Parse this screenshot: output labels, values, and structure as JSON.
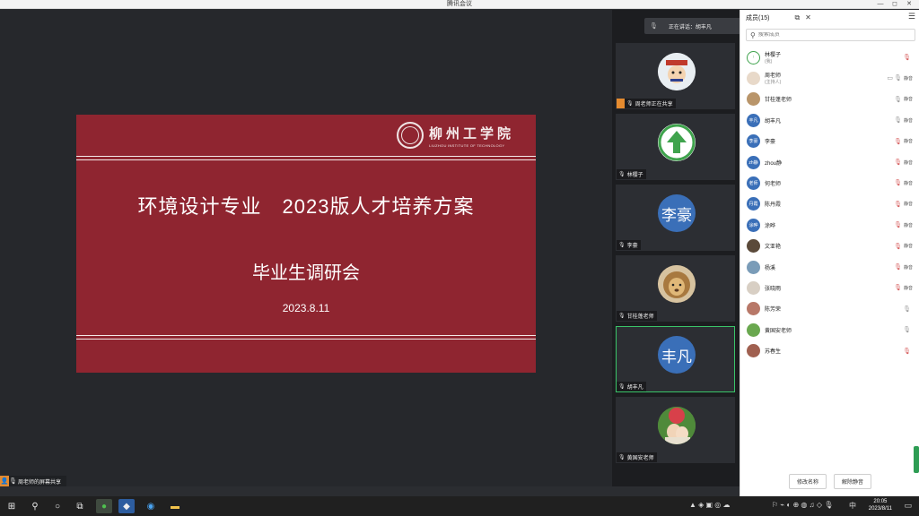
{
  "window": {
    "title": "腾讯会议",
    "controls": [
      "—",
      "◻",
      "✕"
    ]
  },
  "slide": {
    "logo_cn": "柳州工学院",
    "logo_en": "LIUZHOU INSTITUTE OF TECHNOLOGY",
    "title": "环境设计专业　2023版人才培养方案",
    "subtitle": "毕业生调研会",
    "date": "2023.8.11"
  },
  "share_badge": "周老师的屏幕共享",
  "speaking": {
    "label": "正在讲话：胡丰凡"
  },
  "video_tiles": [
    {
      "name": "周老师正在共享",
      "avatar_text": "",
      "color": "#f0f0f0",
      "sharing": true
    },
    {
      "name": "林樱子",
      "avatar_text": "",
      "color": "#ffffff"
    },
    {
      "name": "李豪",
      "avatar_text": "李豪",
      "color": "#3a6fb8"
    },
    {
      "name": "甘桂蓬老师",
      "avatar_text": "",
      "color": "#c9b08a"
    },
    {
      "name": "胡丰凡",
      "avatar_text": "丰凡",
      "color": "#3a6fb8",
      "active": true
    },
    {
      "name": "黄国安老师",
      "avatar_text": "",
      "color": "#6aa84f"
    }
  ],
  "panel": {
    "title": "成员(15)",
    "search_placeholder": "搜索成员",
    "members": [
      {
        "name": "林樱子",
        "sub": "(我)",
        "avatar_text": "↑",
        "color": "#ffffff",
        "mic": "muted",
        "action": ""
      },
      {
        "name": "周老师",
        "sub": "(主持人)",
        "avatar_text": "",
        "color": "#e8d9c9",
        "mic": "on",
        "action": "静音",
        "cam": true
      },
      {
        "name": "甘桂蓬老师",
        "sub": "",
        "avatar_text": "",
        "color": "#b9956a",
        "mic": "on",
        "action": "静音"
      },
      {
        "name": "胡丰凡",
        "sub": "",
        "avatar_text": "丰凡",
        "color": "#3a6fb8",
        "mic": "on",
        "action": "静音"
      },
      {
        "name": "李豪",
        "sub": "",
        "avatar_text": "李豪",
        "color": "#3a6fb8",
        "mic": "muted",
        "action": "静音"
      },
      {
        "name": "zhou静",
        "sub": "",
        "avatar_text": "zh静",
        "color": "#3a6fb8",
        "mic": "muted",
        "action": "静音"
      },
      {
        "name": "何老师",
        "sub": "",
        "avatar_text": "老师",
        "color": "#3a6fb8",
        "mic": "muted",
        "action": "静音"
      },
      {
        "name": "陈丹霞",
        "sub": "",
        "avatar_text": "丹霞",
        "color": "#3a6fb8",
        "mic": "muted",
        "action": "静音"
      },
      {
        "name": "涂晔",
        "sub": "",
        "avatar_text": "涂晔",
        "color": "#3a6fb8",
        "mic": "muted",
        "action": "静音"
      },
      {
        "name": "文亚艳",
        "sub": "",
        "avatar_text": "",
        "color": "#5b4a3a",
        "mic": "muted",
        "action": "静音"
      },
      {
        "name": "杨溪",
        "sub": "",
        "avatar_text": "",
        "color": "#7a9cb8",
        "mic": "muted",
        "action": "静音"
      },
      {
        "name": "张晓雨",
        "sub": "",
        "avatar_text": "",
        "color": "#d8cfc4",
        "mic": "muted",
        "action": "静音"
      },
      {
        "name": "陈芳荣",
        "sub": "",
        "avatar_text": "",
        "color": "#b87868",
        "mic": "off",
        "action": ""
      },
      {
        "name": "黄国安老师",
        "sub": "",
        "avatar_text": "",
        "color": "#6aa84f",
        "mic": "off",
        "action": ""
      },
      {
        "name": "苏春生",
        "sub": "",
        "avatar_text": "",
        "color": "#a06050",
        "mic": "muted",
        "action": ""
      }
    ],
    "rename_button": "修改名称",
    "unmute_button": "解除静音"
  },
  "taskbar": {
    "clock_time": "20:05",
    "clock_date": "2023/8/11",
    "ime": "中"
  }
}
